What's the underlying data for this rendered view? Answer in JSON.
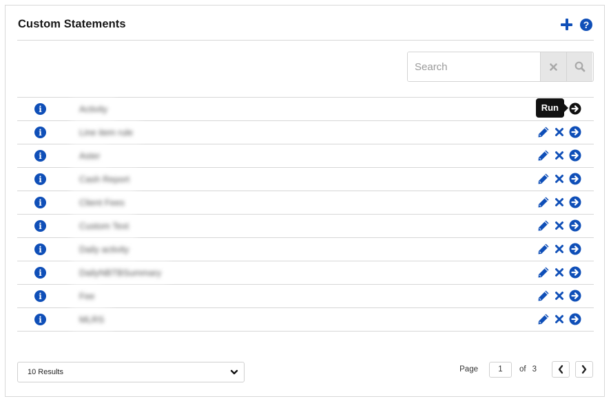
{
  "header": {
    "title": "Custom Statements",
    "add_icon": "plus-icon",
    "help_icon": "question-circle-icon"
  },
  "search": {
    "placeholder": "Search",
    "value": "",
    "clear_icon": "x-icon",
    "search_icon": "magnifier-icon"
  },
  "rows": [
    {
      "name": "Activity",
      "tooltip": "Run"
    },
    {
      "name": "Line item rule",
      "tooltip": null
    },
    {
      "name": "Aster",
      "tooltip": null
    },
    {
      "name": "Cash Report",
      "tooltip": null
    },
    {
      "name": "Client Fees",
      "tooltip": null
    },
    {
      "name": "Custom Text",
      "tooltip": null
    },
    {
      "name": "Daily activity",
      "tooltip": null
    },
    {
      "name": "DailyNBTBSummary",
      "tooltip": null
    },
    {
      "name": "Fee",
      "tooltip": null
    },
    {
      "name": "MLRS",
      "tooltip": null
    }
  ],
  "row_actions": {
    "info_icon": "info-circle-icon",
    "edit_icon": "pencil-icon",
    "delete_icon": "x-icon",
    "run_icon": "arrow-circle-right-icon"
  },
  "tooltip": {
    "label": "Run"
  },
  "footer": {
    "results_select": {
      "value": "10 Results"
    },
    "pager": {
      "page_label": "Page",
      "current_page": "1",
      "of_label": "of",
      "total_pages": "3"
    }
  },
  "colors": {
    "accent": "#0f4fb8",
    "tooltip_bg": "#111111",
    "border": "#d6d6d6"
  }
}
